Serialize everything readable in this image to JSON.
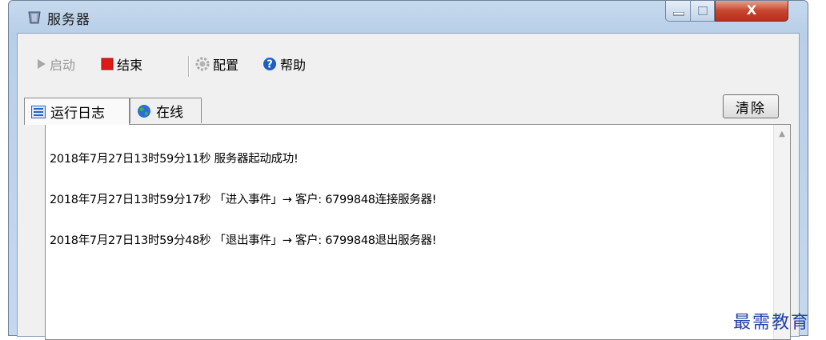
{
  "window": {
    "title": "服务器",
    "controls": {
      "minimize": "▭",
      "maximize": "□",
      "close": "X"
    }
  },
  "toolbar": {
    "start_label": "启动",
    "stop_label": "结束",
    "config_label": "配置",
    "help_label": "帮助"
  },
  "tabs": [
    {
      "label": "运行日志",
      "icon": "list-icon"
    },
    {
      "label": "在线",
      "icon": "globe-icon"
    }
  ],
  "clear_button": "清除",
  "log": [
    "2018年7月27日13时59分11秒 服务器起动成功!",
    "2018年7月27日13时59分17秒 「进入事件」→ 客户: 6799848连接服务器!",
    "2018年7月27日13时59分48秒 「退出事件」→ 客户: 6799848退出服务器!"
  ],
  "watermark": "最需教育",
  "colors": {
    "stop_red": "#e01818",
    "help_blue": "#1f5fbf",
    "watermark_blue": "#2340a8"
  }
}
